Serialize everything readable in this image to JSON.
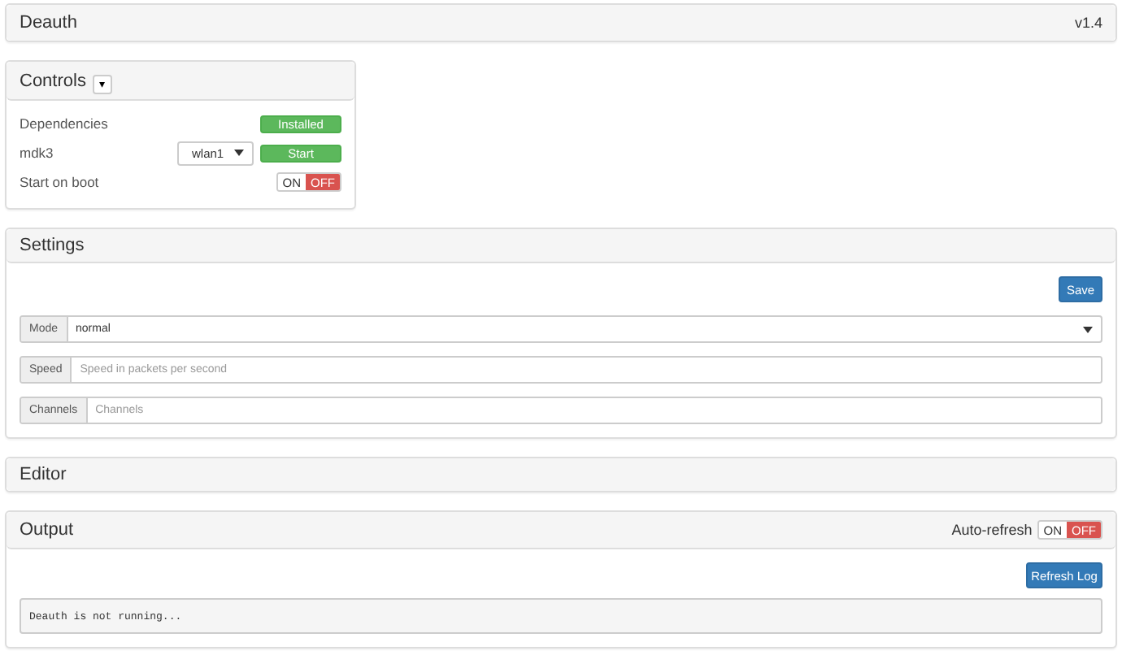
{
  "header": {
    "title": "Deauth",
    "version": "v1.4"
  },
  "controls": {
    "title": "Controls",
    "caret": "▾",
    "rows": [
      {
        "kind": "status",
        "label": "Dependencies",
        "button": "Installed"
      },
      {
        "kind": "select",
        "label": "mdk3",
        "select": "wlan1",
        "button": "Start"
      },
      {
        "kind": "toggle",
        "label": "Start on boot",
        "on_label": "ON",
        "off_label": "OFF",
        "on": false
      }
    ]
  },
  "settings": {
    "title": "Settings",
    "save": "Save",
    "fields": [
      {
        "kind": "select",
        "label": "Mode",
        "value": "normal"
      },
      {
        "kind": "input",
        "label": "Speed",
        "placeholder": "Speed in packets per second"
      },
      {
        "kind": "input",
        "label": "Channels",
        "placeholder": "Channels"
      }
    ]
  },
  "editor": {
    "title": "Editor"
  },
  "output": {
    "title": "Output",
    "auto_refresh": {
      "label": "Auto-refresh",
      "on_label": "ON",
      "off_label": "OFF",
      "on": false
    },
    "refresh": "Refresh Log",
    "log": "Deauth is not running..."
  }
}
